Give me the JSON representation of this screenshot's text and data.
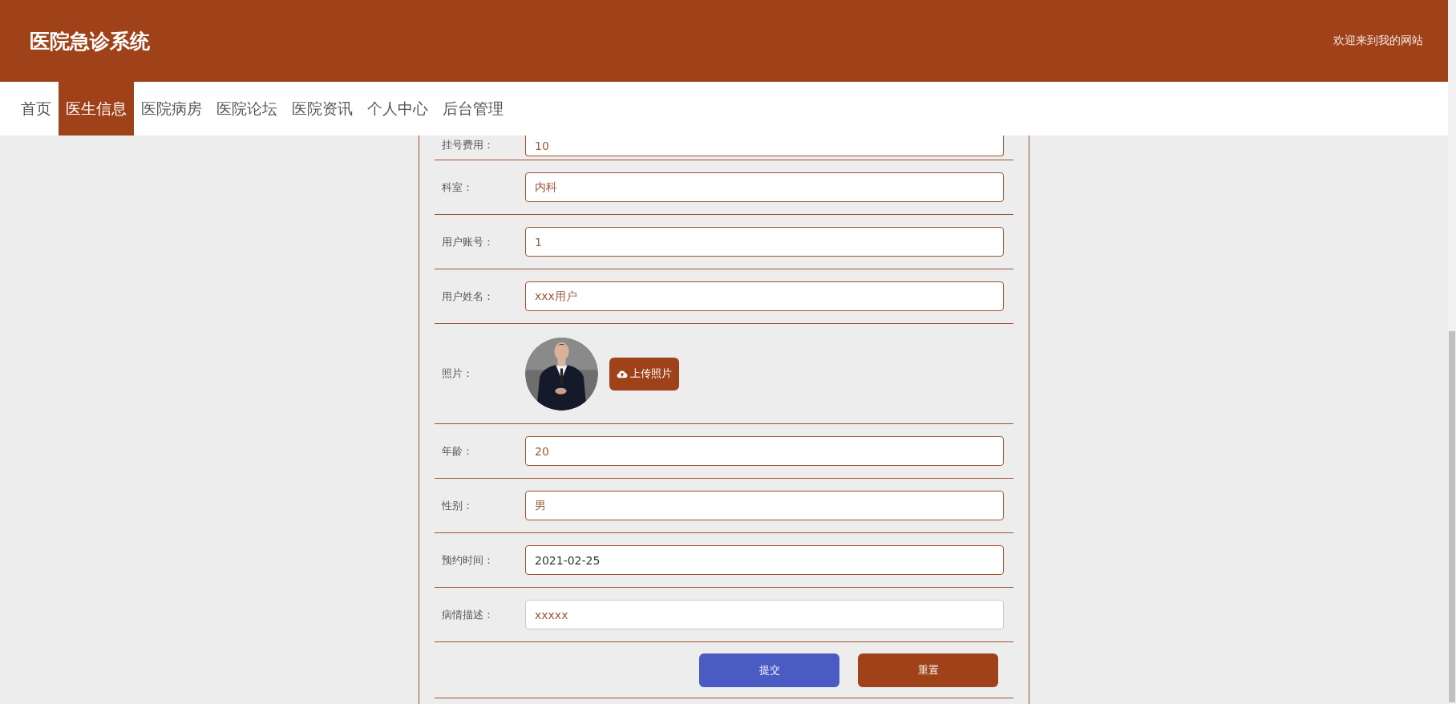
{
  "header": {
    "title": "医院急诊系统",
    "welcome": "欢迎来到我的网站"
  },
  "nav": [
    {
      "label": "首页",
      "selected": false
    },
    {
      "label": "医生信息",
      "selected": true
    },
    {
      "label": "医院病房",
      "selected": false
    },
    {
      "label": "医院论坛",
      "selected": false
    },
    {
      "label": "医院资讯",
      "selected": false
    },
    {
      "label": "个人中心",
      "selected": false
    },
    {
      "label": "后台管理",
      "selected": false
    }
  ],
  "form": {
    "fields": [
      {
        "kind": "text",
        "label": "挂号费用：",
        "value": "10",
        "readonly": true
      },
      {
        "kind": "text",
        "label": "科室：",
        "value": "内科",
        "readonly": true
      },
      {
        "kind": "text",
        "label": "用户账号：",
        "value": "1",
        "readonly": true
      },
      {
        "kind": "text",
        "label": "用户姓名：",
        "value": "xxx用户",
        "readonly": true
      },
      {
        "label": "照片：",
        "button": "上传照片"
      },
      {
        "kind": "text",
        "label": "年龄：",
        "value": "20",
        "readonly": true
      },
      {
        "kind": "text",
        "label": "性别：",
        "value": "男",
        "readonly": true
      },
      {
        "kind": "date",
        "label": "预约时间：",
        "value": "2021-02-25",
        "readonly": true
      },
      {
        "kind": "text",
        "label": "病情描述：",
        "value": "xxxxx",
        "readonly": false
      }
    ],
    "buttons": [
      {
        "kind": "primary",
        "label": "提交"
      },
      {
        "kind": "danger",
        "label": "重置"
      }
    ]
  }
}
